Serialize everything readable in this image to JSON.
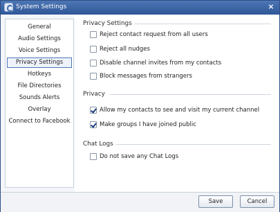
{
  "window": {
    "title": "System Settings",
    "close_label": "×"
  },
  "sidebar": {
    "items": [
      {
        "label": "General",
        "selected": false
      },
      {
        "label": "Audio Settings",
        "selected": false
      },
      {
        "label": "Voice Settings",
        "selected": false
      },
      {
        "label": "Privacy Settings",
        "selected": true
      },
      {
        "label": "Hotkeys",
        "selected": false
      },
      {
        "label": "File Directories",
        "selected": false
      },
      {
        "label": "Sounds Alerts",
        "selected": false
      },
      {
        "label": "Overlay",
        "selected": false
      },
      {
        "label": "Connect to Facebook",
        "selected": false
      }
    ]
  },
  "sections": {
    "privacy_settings": {
      "title": "Privacy Settings",
      "options": [
        {
          "label": "Reject contact request from all users",
          "checked": false
        },
        {
          "label": "Reject all nudges",
          "checked": false
        },
        {
          "label": "Disable channel invites from my contacts",
          "checked": false
        },
        {
          "label": "Block messages from strangers",
          "checked": false
        }
      ]
    },
    "privacy": {
      "title": "Privacy",
      "options": [
        {
          "label": "Allow my contacts to see and visit my current channel",
          "checked": true
        },
        {
          "label": "Make groups I have joined public",
          "checked": true
        }
      ]
    },
    "chat_logs": {
      "title": "Chat Logs",
      "options": [
        {
          "label": "Do not save any Chat Logs",
          "checked": false
        }
      ]
    }
  },
  "footer": {
    "save_label": "Save",
    "cancel_label": "Cancel"
  },
  "colors": {
    "titlebar": "#2f5797",
    "selection_border": "#4e74b3",
    "check_mark": "#1b3b7a"
  }
}
